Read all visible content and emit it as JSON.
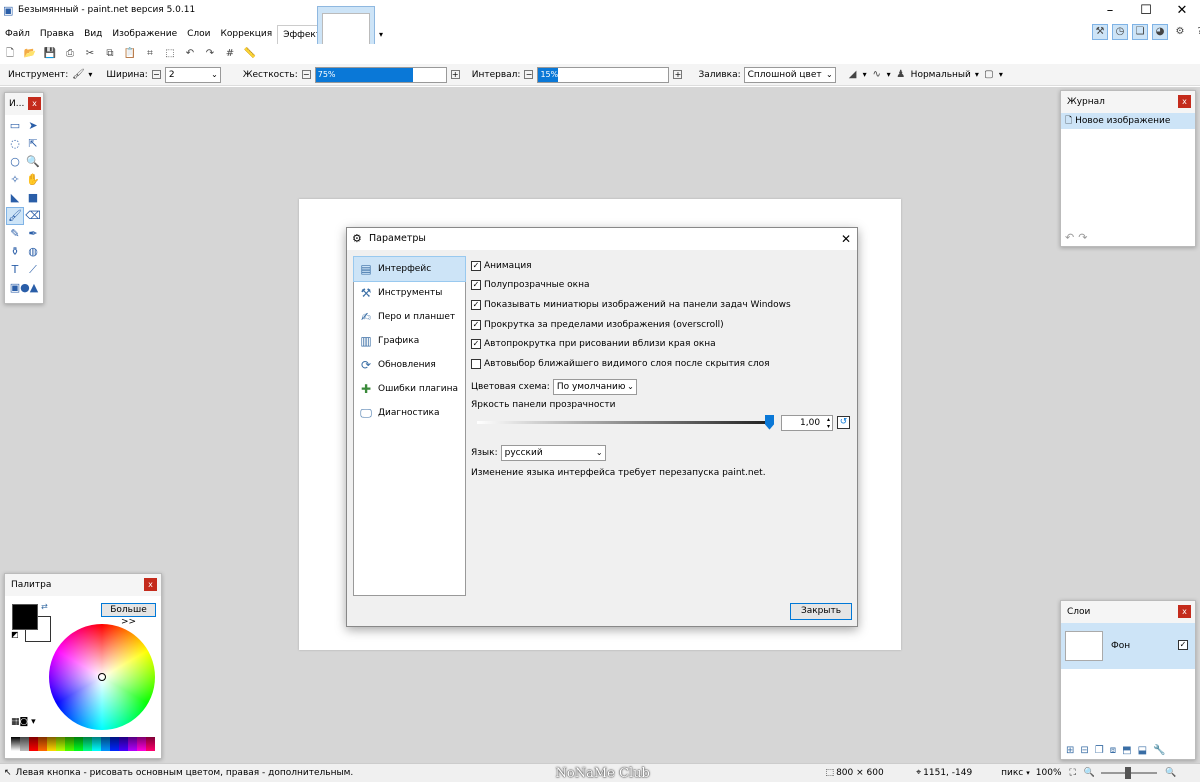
{
  "app": {
    "title": "Безымянный - paint.net версия 5.0.11"
  },
  "menu": [
    "Файл",
    "Правка",
    "Вид",
    "Изображение",
    "Слои",
    "Коррекция",
    "Эффекты"
  ],
  "tool_options": {
    "tool_label": "Инструмент:",
    "width_label": "Ширина:",
    "width_value": "2",
    "hardness_label": "Жесткость:",
    "hardness_value": "75%",
    "hardness_fraction": 0.75,
    "interval_label": "Интервал:",
    "interval_value": "15%",
    "interval_fraction": 0.15,
    "fill_label": "Заливка:",
    "fill_value": "Сплошной цвет",
    "blend_value": "Нормальный"
  },
  "tools_panel": {
    "title": "И..."
  },
  "history_panel": {
    "title": "Журнал",
    "items": [
      "Новое изображение"
    ]
  },
  "palette_panel": {
    "title": "Палитра",
    "more_button": "Больше >>"
  },
  "layers_panel": {
    "title": "Слои",
    "layer_name": "Фон"
  },
  "dialog": {
    "title": "Параметры",
    "sidebar": [
      "Интерфейс",
      "Инструменты",
      "Перо и планшет",
      "Графика",
      "Обновления",
      "Ошибки плагина",
      "Диагностика"
    ],
    "checkboxes": [
      {
        "label": "Анимация",
        "checked": true
      },
      {
        "label": "Полупрозрачные окна",
        "checked": true
      },
      {
        "label": "Показывать миниатюры изображений на панели задач Windows",
        "checked": true
      },
      {
        "label": "Прокрутка за пределами изображения (overscroll)",
        "checked": true
      },
      {
        "label": "Автопрокрутка при рисовании вблизи края окна",
        "checked": true
      },
      {
        "label": "Автовыбор ближайшего видимого слоя после скрытия слоя",
        "checked": false
      }
    ],
    "color_scheme_label": "Цветовая схема:",
    "color_scheme_value": "По умолчанию",
    "brightness_label": "Яркость панели прозрачности",
    "brightness_value": "1,00",
    "language_label": "Язык:",
    "language_value": "русский",
    "language_note": "Изменение языка интерфейса требует перезапуска paint.net.",
    "close_button": "Закрыть"
  },
  "status": {
    "hint": "Левая кнопка - рисовать основным цветом, правая - дополнительным.",
    "watermark": "NoNaMe Club",
    "size": "800 × 600",
    "coords": "1151, -149",
    "unit": "пикс",
    "zoom": "100%"
  },
  "colors": {
    "accent": "#0a78d7",
    "selection": "#cde4f7",
    "close": "#c42b1c"
  }
}
